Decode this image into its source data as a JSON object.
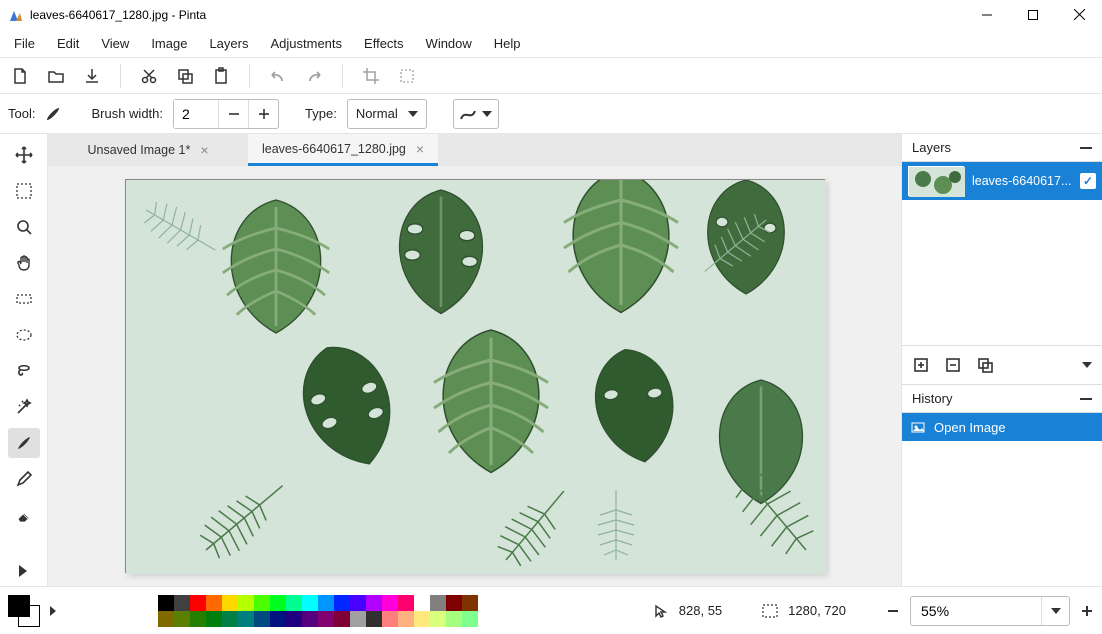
{
  "window": {
    "title": "leaves-6640617_1280.jpg - Pinta"
  },
  "menu": {
    "file": "File",
    "edit": "Edit",
    "view": "View",
    "image": "Image",
    "layers": "Layers",
    "adjustments": "Adjustments",
    "effects": "Effects",
    "window": "Window",
    "help": "Help"
  },
  "tooloptions": {
    "tool_label": "Tool:",
    "brush_label": "Brush width:",
    "brush_value": "2",
    "type_label": "Type:",
    "type_value": "Normal"
  },
  "tabs": [
    {
      "label": "Unsaved Image 1*",
      "active": false
    },
    {
      "label": "leaves-6640617_1280.jpg",
      "active": true
    }
  ],
  "rightpanel": {
    "layers_label": "Layers",
    "layer_name": "leaves-6640617...",
    "history_label": "History",
    "history_item": "Open Image"
  },
  "status": {
    "cursor": "828, 55",
    "size": "1280, 720",
    "zoom": "55%"
  },
  "palette": [
    "#000000",
    "#404040",
    "#ff0000",
    "#ff6a00",
    "#ffd800",
    "#b6ff00",
    "#4cff00",
    "#00ff21",
    "#00ff90",
    "#00ffff",
    "#0094ff",
    "#0026ff",
    "#4800ff",
    "#b200ff",
    "#ff00dc",
    "#ff006e",
    "#ffffff",
    "#808080",
    "#7f0000",
    "#7f3300",
    "#7f6a00",
    "#5b7f00",
    "#267f00",
    "#007f0e",
    "#007f46",
    "#007f7f",
    "#004a7f",
    "#00137f",
    "#21007f",
    "#57007f",
    "#7f006e",
    "#7f0037",
    "#a0a0a0",
    "#303030",
    "#ff7f7f",
    "#ffb27f",
    "#ffe97f",
    "#daff7f",
    "#a5ff7f",
    "#7fff8e",
    "#7fffc5",
    "#7fffff",
    "#7fc9ff",
    "#7f92ff",
    "#a17fff",
    "#d67fff",
    "#ff7fed",
    "#ff7fb6",
    "#c0c0c0",
    "#606060",
    "#ffb2b2",
    "#ffd1b2",
    "#fff0b2",
    "#ecffb2",
    "#d2ffb2",
    "#b2ffce",
    "#b2ffe2",
    "#b2ffff",
    "#b2e4ff",
    "#b2c8ff",
    "#d0b2ff",
    "#eab2ff",
    "#ffb2f6",
    "#ffb2da"
  ]
}
